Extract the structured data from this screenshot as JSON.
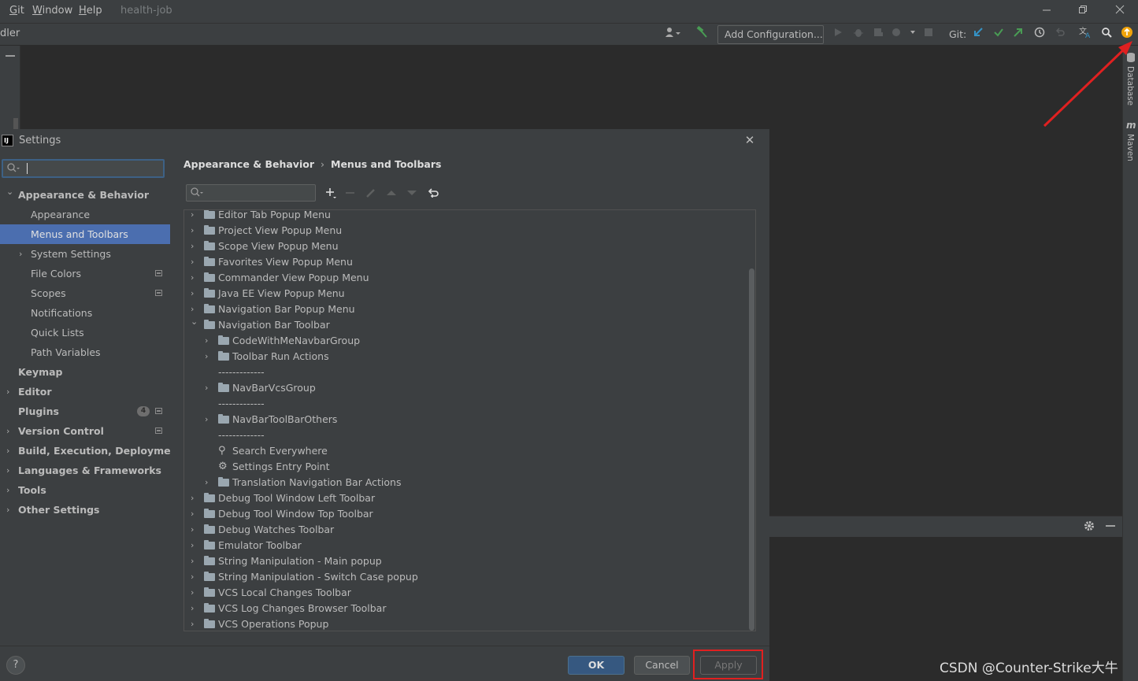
{
  "menubar": {
    "items": [
      {
        "label": "Git",
        "mnemonic": "G",
        "rest": "it"
      },
      {
        "label": "Window",
        "mnemonic": "W",
        "rest": "indow"
      },
      {
        "label": "Help",
        "mnemonic": "H",
        "rest": "elp"
      }
    ],
    "project_title": "health-job"
  },
  "toolbar": {
    "nav_crumb": "dler",
    "add_configuration": "Add Configuration...",
    "git_label": "Git:"
  },
  "right_strip": {
    "database_label": "Database",
    "maven_label": "Maven",
    "maven_glyph": "m"
  },
  "dialog": {
    "title": "Settings",
    "logo_text": "IJ",
    "close_glyph": "✕"
  },
  "sidebar": {
    "search_value": "",
    "items": [
      {
        "label": "Appearance & Behavior",
        "level": 0,
        "expand": "open",
        "bold": true
      },
      {
        "label": "Appearance",
        "level": 1,
        "expand": "none",
        "bold": false
      },
      {
        "label": "Menus and Toolbars",
        "level": 1,
        "expand": "none",
        "bold": false,
        "selected": true
      },
      {
        "label": "System Settings",
        "level": 1,
        "expand": "closed",
        "bold": false
      },
      {
        "label": "File Colors",
        "level": 1,
        "expand": "none",
        "bold": false,
        "project_icon": true
      },
      {
        "label": "Scopes",
        "level": 1,
        "expand": "none",
        "bold": false,
        "project_icon": true
      },
      {
        "label": "Notifications",
        "level": 1,
        "expand": "none",
        "bold": false
      },
      {
        "label": "Quick Lists",
        "level": 1,
        "expand": "none",
        "bold": false
      },
      {
        "label": "Path Variables",
        "level": 1,
        "expand": "none",
        "bold": false
      },
      {
        "label": "Keymap",
        "level": 0,
        "expand": "none",
        "bold": true
      },
      {
        "label": "Editor",
        "level": 0,
        "expand": "closed",
        "bold": true
      },
      {
        "label": "Plugins",
        "level": 0,
        "expand": "none",
        "bold": true,
        "badge": "4",
        "project_icon": true
      },
      {
        "label": "Version Control",
        "level": 0,
        "expand": "closed",
        "bold": true,
        "project_icon": true
      },
      {
        "label": "Build, Execution, Deployment",
        "level": 0,
        "expand": "closed",
        "bold": true
      },
      {
        "label": "Languages & Frameworks",
        "level": 0,
        "expand": "closed",
        "bold": true
      },
      {
        "label": "Tools",
        "level": 0,
        "expand": "closed",
        "bold": true
      },
      {
        "label": "Other Settings",
        "level": 0,
        "expand": "closed",
        "bold": true
      }
    ]
  },
  "content": {
    "breadcrumb": [
      "Appearance & Behavior",
      "Menus and Toolbars"
    ],
    "breadcrumb_sep": "›",
    "search_value": "",
    "tree": [
      {
        "label": "Editor Tab Popup Menu",
        "level": 0,
        "expand": "closed",
        "icon": "folder"
      },
      {
        "label": "Project View Popup Menu",
        "level": 0,
        "expand": "closed",
        "icon": "folder"
      },
      {
        "label": "Scope View Popup Menu",
        "level": 0,
        "expand": "closed",
        "icon": "folder"
      },
      {
        "label": "Favorites View Popup Menu",
        "level": 0,
        "expand": "closed",
        "icon": "folder"
      },
      {
        "label": "Commander View Popup Menu",
        "level": 0,
        "expand": "closed",
        "icon": "folder"
      },
      {
        "label": "Java EE View Popup Menu",
        "level": 0,
        "expand": "closed",
        "icon": "folder"
      },
      {
        "label": "Navigation Bar Popup Menu",
        "level": 0,
        "expand": "closed",
        "icon": "folder"
      },
      {
        "label": "Navigation Bar Toolbar",
        "level": 0,
        "expand": "open",
        "icon": "folder"
      },
      {
        "label": "CodeWithMeNavbarGroup",
        "level": 1,
        "expand": "closed",
        "icon": "folder"
      },
      {
        "label": "Toolbar Run Actions",
        "level": 1,
        "expand": "closed",
        "icon": "folder"
      },
      {
        "label": "-------------",
        "level": 1,
        "expand": "none",
        "icon": "none"
      },
      {
        "label": "NavBarVcsGroup",
        "level": 1,
        "expand": "closed",
        "icon": "folder"
      },
      {
        "label": "-------------",
        "level": 1,
        "expand": "none",
        "icon": "none"
      },
      {
        "label": "NavBarToolBarOthers",
        "level": 1,
        "expand": "closed",
        "icon": "folder"
      },
      {
        "label": "-------------",
        "level": 1,
        "expand": "none",
        "icon": "none"
      },
      {
        "label": "Search Everywhere",
        "level": 1,
        "expand": "none",
        "icon": "search"
      },
      {
        "label": "Settings Entry Point",
        "level": 1,
        "expand": "none",
        "icon": "gear"
      },
      {
        "label": "Translation Navigation Bar Actions",
        "level": 1,
        "expand": "closed",
        "icon": "folder"
      },
      {
        "label": "Debug Tool Window Left Toolbar",
        "level": 0,
        "expand": "closed",
        "icon": "folder"
      },
      {
        "label": "Debug Tool Window Top Toolbar",
        "level": 0,
        "expand": "closed",
        "icon": "folder"
      },
      {
        "label": "Debug Watches Toolbar",
        "level": 0,
        "expand": "closed",
        "icon": "folder"
      },
      {
        "label": "Emulator Toolbar",
        "level": 0,
        "expand": "closed",
        "icon": "folder"
      },
      {
        "label": "String Manipulation - Main popup",
        "level": 0,
        "expand": "closed",
        "icon": "folder"
      },
      {
        "label": "String Manipulation - Switch Case popup",
        "level": 0,
        "expand": "closed",
        "icon": "folder"
      },
      {
        "label": "VCS Local Changes Toolbar",
        "level": 0,
        "expand": "closed",
        "icon": "folder"
      },
      {
        "label": "VCS Log Changes Browser Toolbar",
        "level": 0,
        "expand": "closed",
        "icon": "folder"
      },
      {
        "label": "VCS Operations Popup",
        "level": 0,
        "expand": "closed",
        "icon": "folder"
      }
    ]
  },
  "footer": {
    "help_glyph": "?",
    "ok_label": "OK",
    "cancel_label": "Cancel",
    "apply_label": "Apply"
  },
  "watermark": "CSDN @Counter-Strike大牛",
  "colors": {
    "selection": "#4b6eaf",
    "ok_button": "#365880",
    "annotation_red": "#e02020",
    "update_badge": "#f0a30a"
  }
}
